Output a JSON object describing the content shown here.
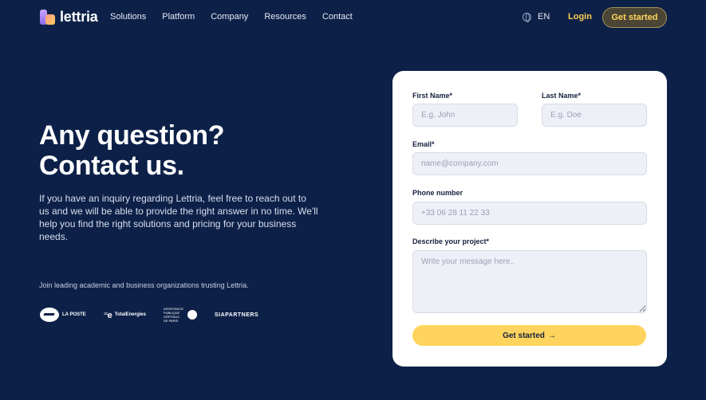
{
  "nav": {
    "brand": "lettria",
    "links": [
      "Solutions",
      "Platform",
      "Company",
      "Resources",
      "Contact"
    ],
    "lang": "EN",
    "login": "Login",
    "cta": "Get started"
  },
  "hero": {
    "title_line1": "Any question?",
    "title_line2": "Contact us.",
    "description": "If you have an inquiry regarding Lettria, feel free to reach out to us and we will be able to provide the right answer in no time. We'll help you find the right solutions and pricing for your business needs.",
    "trust_text": "Join leading academic and business organizations trusting Lettria.",
    "logos": {
      "laposte": "LA POSTE",
      "total": "TotalEnergies",
      "aphp": "ASSISTANCE PUBLIQUE HÔPITAUX DE PARIS",
      "sia": "SIAPARTNERS"
    }
  },
  "form": {
    "first_name_label": "First Name*",
    "first_name_placeholder": "E.g. John",
    "last_name_label": "Last Name*",
    "last_name_placeholder": "E.g. Doe",
    "email_label": "Email*",
    "email_placeholder": "name@company.com",
    "phone_label": "Phone number",
    "phone_placeholder": "+33 06 28 11 22 33",
    "project_label": "Describe your project*",
    "project_placeholder": "Write your message here..",
    "submit_label": "Get started",
    "submit_arrow": "→"
  },
  "colors": {
    "background": "#0d2148",
    "accent": "#ffd45e",
    "login": "#ffce4f"
  }
}
